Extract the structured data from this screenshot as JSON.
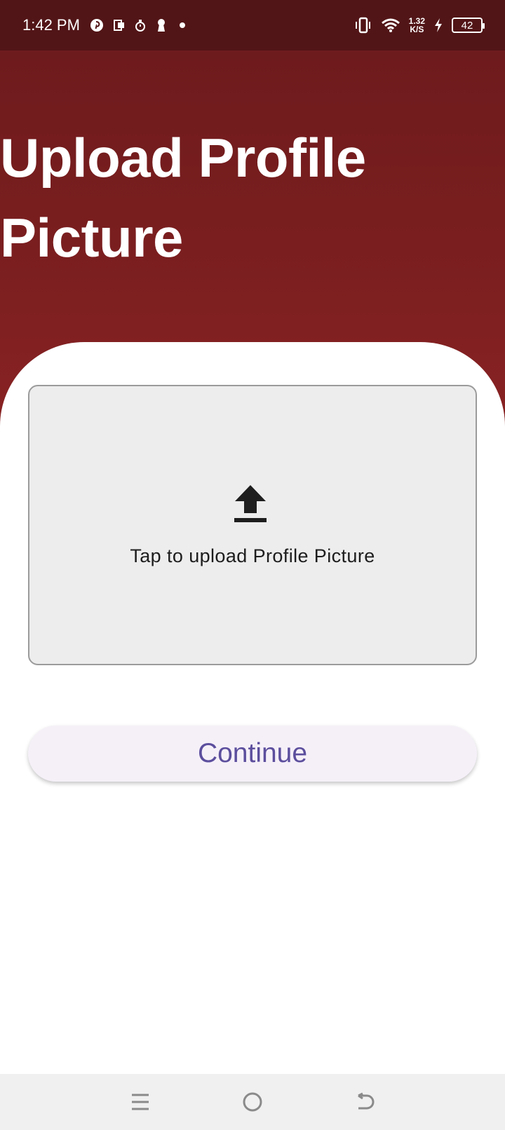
{
  "status_bar": {
    "time": "1:42 PM",
    "net_speed_value": "1.32",
    "net_speed_unit": "K/S",
    "battery": "42",
    "icons": [
      "pinterest-icon",
      "office-icon",
      "stopwatch-icon",
      "keyhole-icon",
      "dot-icon",
      "vibrate-icon",
      "wifi-icon",
      "charging-icon",
      "battery-icon"
    ]
  },
  "header": {
    "title": "Upload Profile Picture"
  },
  "upload": {
    "icon": "upload-icon",
    "label": "Tap to upload Profile Picture"
  },
  "actions": {
    "continue_label": "Continue"
  },
  "nav_bar": {
    "buttons": [
      "menu-icon",
      "home-icon",
      "back-icon"
    ]
  },
  "colors": {
    "status_bar_bg": "#521517",
    "header_bg": "#7d1f20",
    "upload_box_bg": "#ededed",
    "button_bg": "#f5f0f8",
    "button_text": "#5c4e9d"
  }
}
